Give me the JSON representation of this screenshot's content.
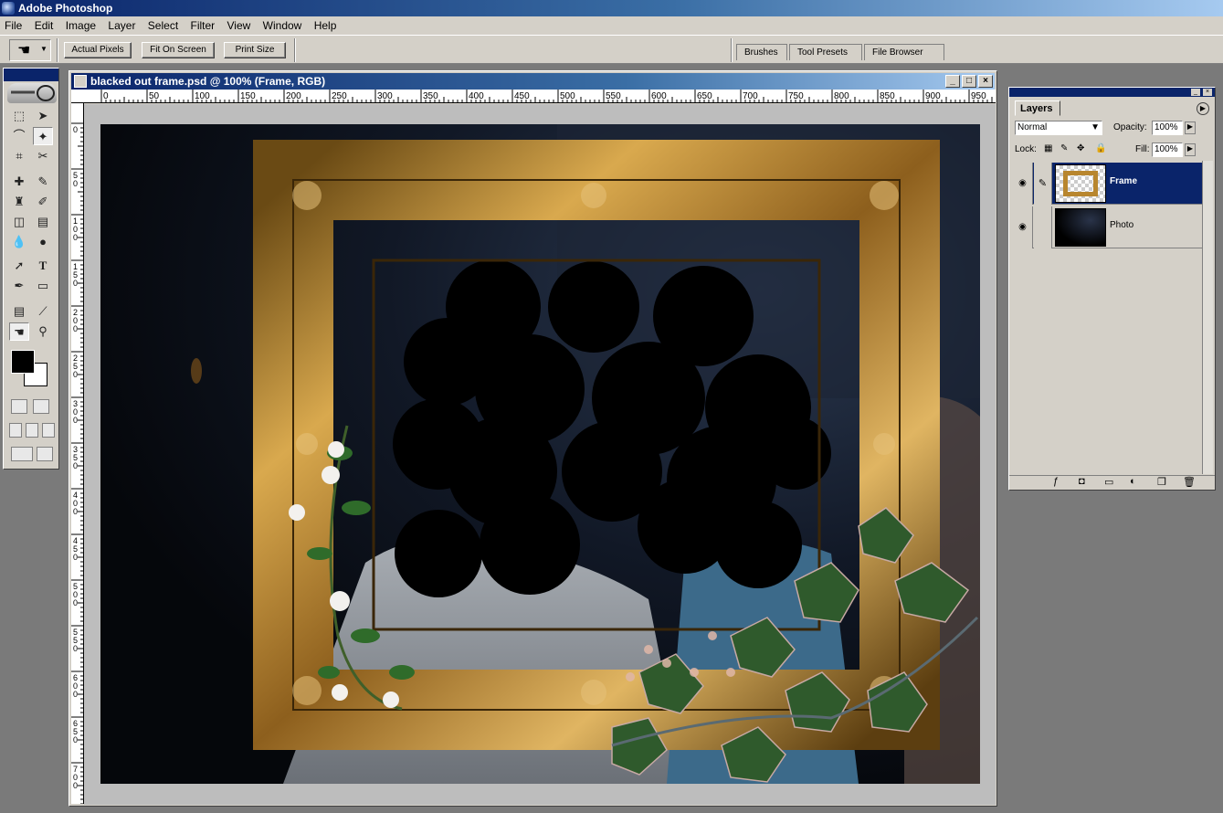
{
  "app": {
    "title": "Adobe Photoshop"
  },
  "menu": [
    "File",
    "Edit",
    "Image",
    "Layer",
    "Select",
    "Filter",
    "View",
    "Window",
    "Help"
  ],
  "options_bar": {
    "actual_pixels": "Actual Pixels",
    "fit_on_screen": "Fit On Screen",
    "print_size": "Print Size"
  },
  "palette_well": {
    "tabs": [
      "Brushes",
      "Tool Presets",
      "File Browser"
    ]
  },
  "document": {
    "title": "blacked out frame.psd @ 100% (Frame, RGB)",
    "ruler_h": [
      "0",
      "50",
      "100",
      "150",
      "200",
      "250",
      "300",
      "350",
      "400",
      "450",
      "500",
      "550",
      "600",
      "650",
      "700",
      "750",
      "800",
      "850",
      "900",
      "950"
    ],
    "ruler_v": [
      "0",
      "50",
      "100",
      "150",
      "200",
      "250",
      "300",
      "350",
      "400",
      "450",
      "500",
      "550",
      "600",
      "650",
      "700"
    ]
  },
  "layers_palette": {
    "tab": "Layers",
    "blend_mode": "Normal",
    "opacity_label": "Opacity:",
    "opacity_value": "100%",
    "lock_label": "Lock:",
    "fill_label": "Fill:",
    "fill_value": "100%",
    "layers": [
      {
        "name": "Frame",
        "selected": true
      },
      {
        "name": "Photo",
        "selected": false
      }
    ]
  },
  "colors": {
    "title_bar": "#0a246a",
    "chrome": "#d4d0c8",
    "workspace": "#7a7a7a",
    "frame_gold": "#b8862e",
    "ivy_green": "#2f5a2c"
  },
  "icons": [
    "hand-icon",
    "marquee-icon",
    "move-icon",
    "lasso-icon",
    "magic-wand-icon",
    "crop-icon",
    "slice-icon",
    "healing-icon",
    "brush-icon",
    "stamp-icon",
    "history-brush-icon",
    "eraser-icon",
    "gradient-icon",
    "blur-icon",
    "dodge-icon",
    "path-select-icon",
    "type-icon",
    "pen-icon",
    "shape-icon",
    "notes-icon",
    "eyedropper-icon",
    "zoom-icon",
    "eye-icon",
    "brush-link-icon"
  ]
}
